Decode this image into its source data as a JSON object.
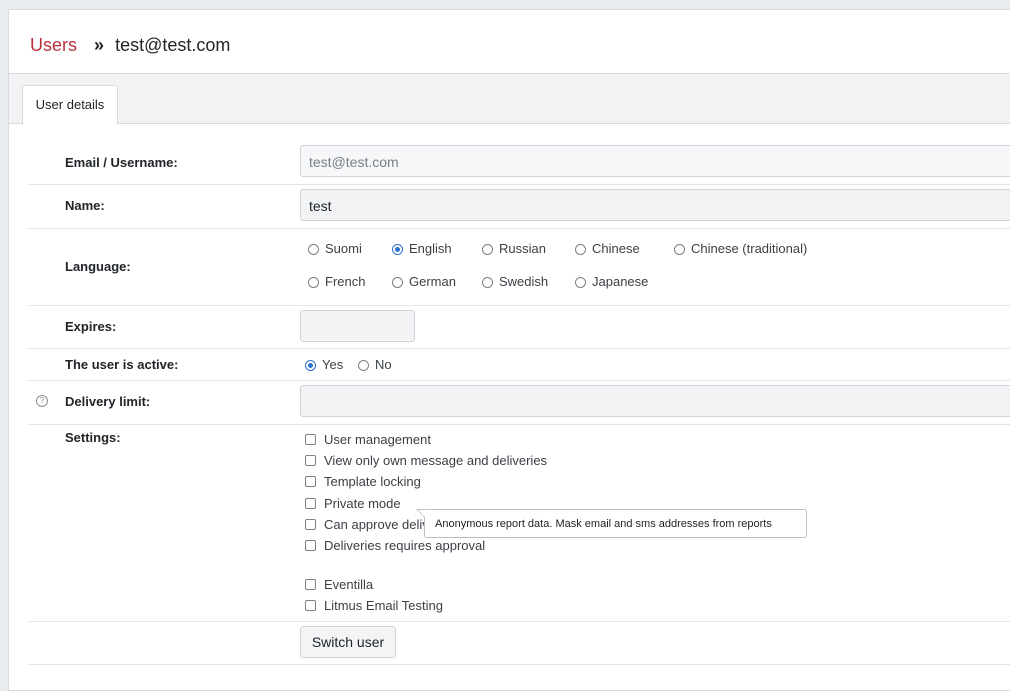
{
  "breadcrumb": {
    "parent": "Users",
    "separator": "»",
    "current": "test@test.com"
  },
  "tabs": [
    {
      "label": "User details"
    }
  ],
  "form": {
    "email": {
      "label": "Email / Username:",
      "value": "test@test.com"
    },
    "name": {
      "label": "Name:",
      "value": "test"
    },
    "language": {
      "label": "Language:",
      "options": [
        "Suomi",
        "English",
        "Russian",
        "Chinese",
        "Chinese (traditional)",
        "French",
        "German",
        "Swedish",
        "Japanese"
      ],
      "selected": "English"
    },
    "expires": {
      "label": "Expires:",
      "value": ""
    },
    "active": {
      "label": "The user is active:",
      "yes": "Yes",
      "no": "No",
      "selected": "Yes"
    },
    "delivery_limit": {
      "label": "Delivery limit:",
      "help": "?",
      "value": ""
    },
    "settings": {
      "label": "Settings:",
      "items": [
        "User management",
        "View only own message and deliveries",
        "Template locking",
        "Private mode",
        "Can approve deliveries",
        "Deliveries requires approval",
        "Eventilla",
        "Litmus Email Testing"
      ]
    },
    "switch_user_label": "Switch user"
  },
  "tooltip": {
    "text": "Anonymous report data. Mask email and sms addresses from reports"
  },
  "colors": {
    "link": "#b8323c",
    "radio_checked": "#2f6fd0"
  }
}
